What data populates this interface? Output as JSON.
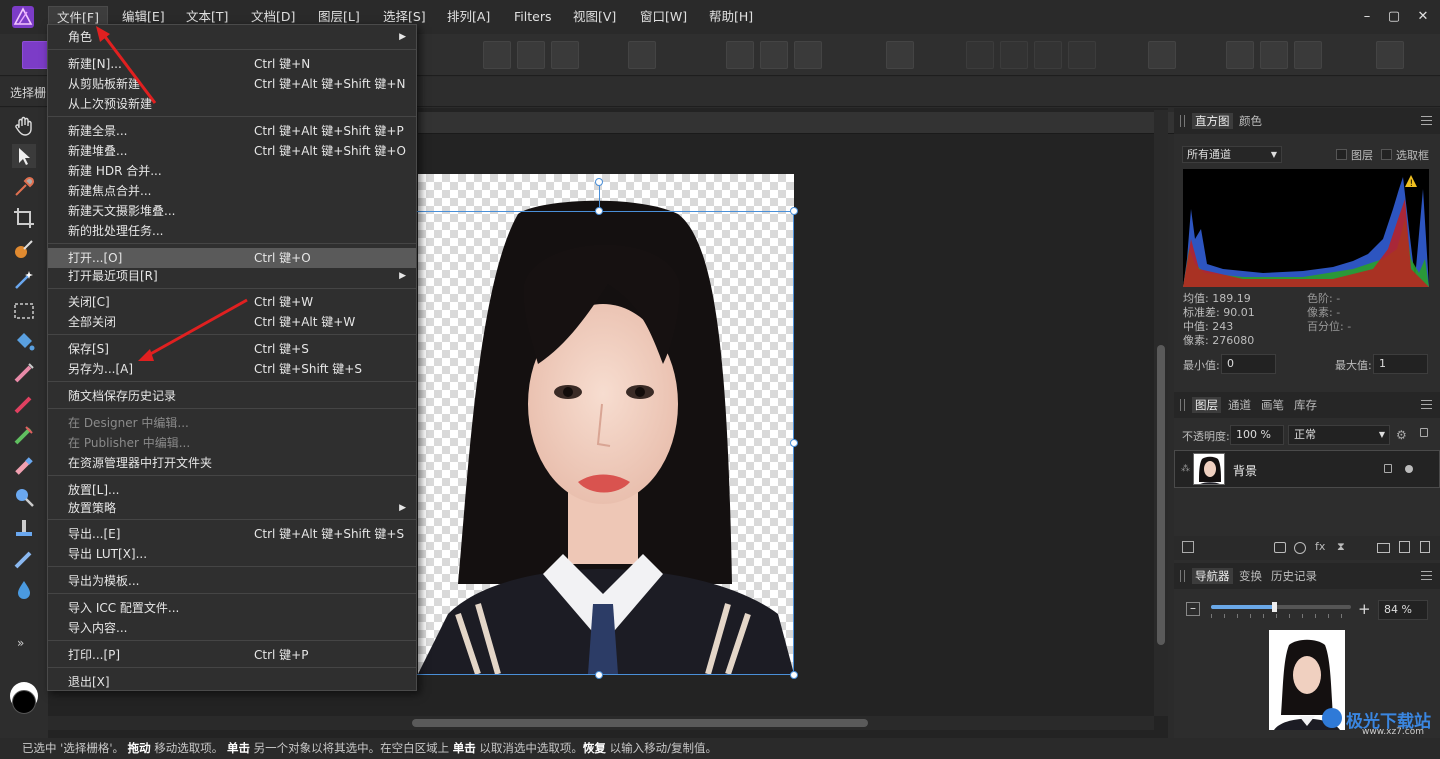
{
  "menubar": {
    "items": [
      "文件[F]",
      "编辑[E]",
      "文本[T]",
      "文档[D]",
      "图层[L]",
      "选择[S]",
      "排列[A]",
      "Filters",
      "视图[V]",
      "窗口[W]",
      "帮助[H]"
    ]
  },
  "context_bar": {
    "label": "选择栅"
  },
  "file_menu": {
    "items": [
      {
        "label": "角色",
        "shortcut": "",
        "submenu": true
      },
      {
        "label": "新建[N]...",
        "shortcut": "Ctrl 键+N"
      },
      {
        "label": "从剪贴板新建",
        "shortcut": "Ctrl 键+Alt 键+Shift 键+N"
      },
      {
        "label": "从上次预设新建",
        "shortcut": ""
      },
      {
        "label": "新建全景...",
        "shortcut": "Ctrl 键+Alt 键+Shift 键+P"
      },
      {
        "label": "新建堆叠...",
        "shortcut": "Ctrl 键+Alt 键+Shift 键+O"
      },
      {
        "label": "新建 HDR 合并...",
        "shortcut": ""
      },
      {
        "label": "新建焦点合并...",
        "shortcut": ""
      },
      {
        "label": "新建天文摄影堆叠...",
        "shortcut": ""
      },
      {
        "label": "新的批处理任务...",
        "shortcut": ""
      },
      {
        "label": "打开...[O]",
        "shortcut": "Ctrl 键+O"
      },
      {
        "label": "打开最近项目[R]",
        "shortcut": "",
        "submenu": true
      },
      {
        "label": "关闭[C]",
        "shortcut": "Ctrl 键+W"
      },
      {
        "label": "全部关闭",
        "shortcut": "Ctrl 键+Alt 键+W"
      },
      {
        "label": "保存[S]",
        "shortcut": "Ctrl 键+S"
      },
      {
        "label": "另存为...[A]",
        "shortcut": "Ctrl 键+Shift 键+S"
      },
      {
        "label": "随文档保存历史记录",
        "shortcut": ""
      },
      {
        "label": "在 Designer 中编辑...",
        "shortcut": "",
        "disabled": true
      },
      {
        "label": "在 Publisher 中编辑...",
        "shortcut": "",
        "disabled": true
      },
      {
        "label": "在资源管理器中打开文件夹",
        "shortcut": ""
      },
      {
        "label": "放置[L]...",
        "shortcut": ""
      },
      {
        "label": "放置策略",
        "shortcut": "",
        "submenu": true
      },
      {
        "label": "导出...[E]",
        "shortcut": "Ctrl 键+Alt 键+Shift 键+S"
      },
      {
        "label": "导出 LUT[X]...",
        "shortcut": ""
      },
      {
        "label": "导出为模板...",
        "shortcut": ""
      },
      {
        "label": "导入 ICC 配置文件...",
        "shortcut": ""
      },
      {
        "label": "导入内容...",
        "shortcut": ""
      },
      {
        "label": "打印...[P]",
        "shortcut": "Ctrl 键+P"
      },
      {
        "label": "退出[X]",
        "shortcut": ""
      }
    ]
  },
  "histogram_panel": {
    "tabs": [
      "直方图",
      "颜色"
    ],
    "channel": "所有通道",
    "check_layer": "图层",
    "check_marquee": "选取框",
    "stats_left": [
      "均值: 189.19",
      "标准差: 90.01",
      "中值: 243",
      "像素: 276080"
    ],
    "stats_right": [
      "色阶: -",
      "像素: -",
      "百分位: -"
    ],
    "min_label": "最小值:",
    "min_value": "0",
    "max_label": "最大值:",
    "max_value": "1"
  },
  "layers_panel": {
    "tabs": [
      "图层",
      "通道",
      "画笔",
      "库存"
    ],
    "opacity_label": "不透明度:",
    "opacity_value": "100 %",
    "blend_mode": "正常",
    "layer_name": "背景"
  },
  "navigator_panel": {
    "tabs": [
      "导航器",
      "变换",
      "历史记录"
    ],
    "zoom_value": "84 %",
    "zoom_fraction": 0.45
  },
  "statusbar": {
    "p1": "已选中 '选择栅格'。",
    "b1": "拖动",
    "p2": " 移动选取项。",
    "b2": "单击",
    "p3": " 另一个对象以将其选中。在空白区域上 ",
    "b3": "单击",
    "p4": " 以取消选中选取项。",
    "b4": "恢复",
    "p5": " 以输入移动/复制值。"
  },
  "watermark": {
    "text": "极光下载站",
    "url_text": "www.xz7.com"
  },
  "colors": {
    "accent_blue": "#4a8fd8",
    "arrow_red": "#e02020",
    "app_purple": "#a23bd6"
  }
}
